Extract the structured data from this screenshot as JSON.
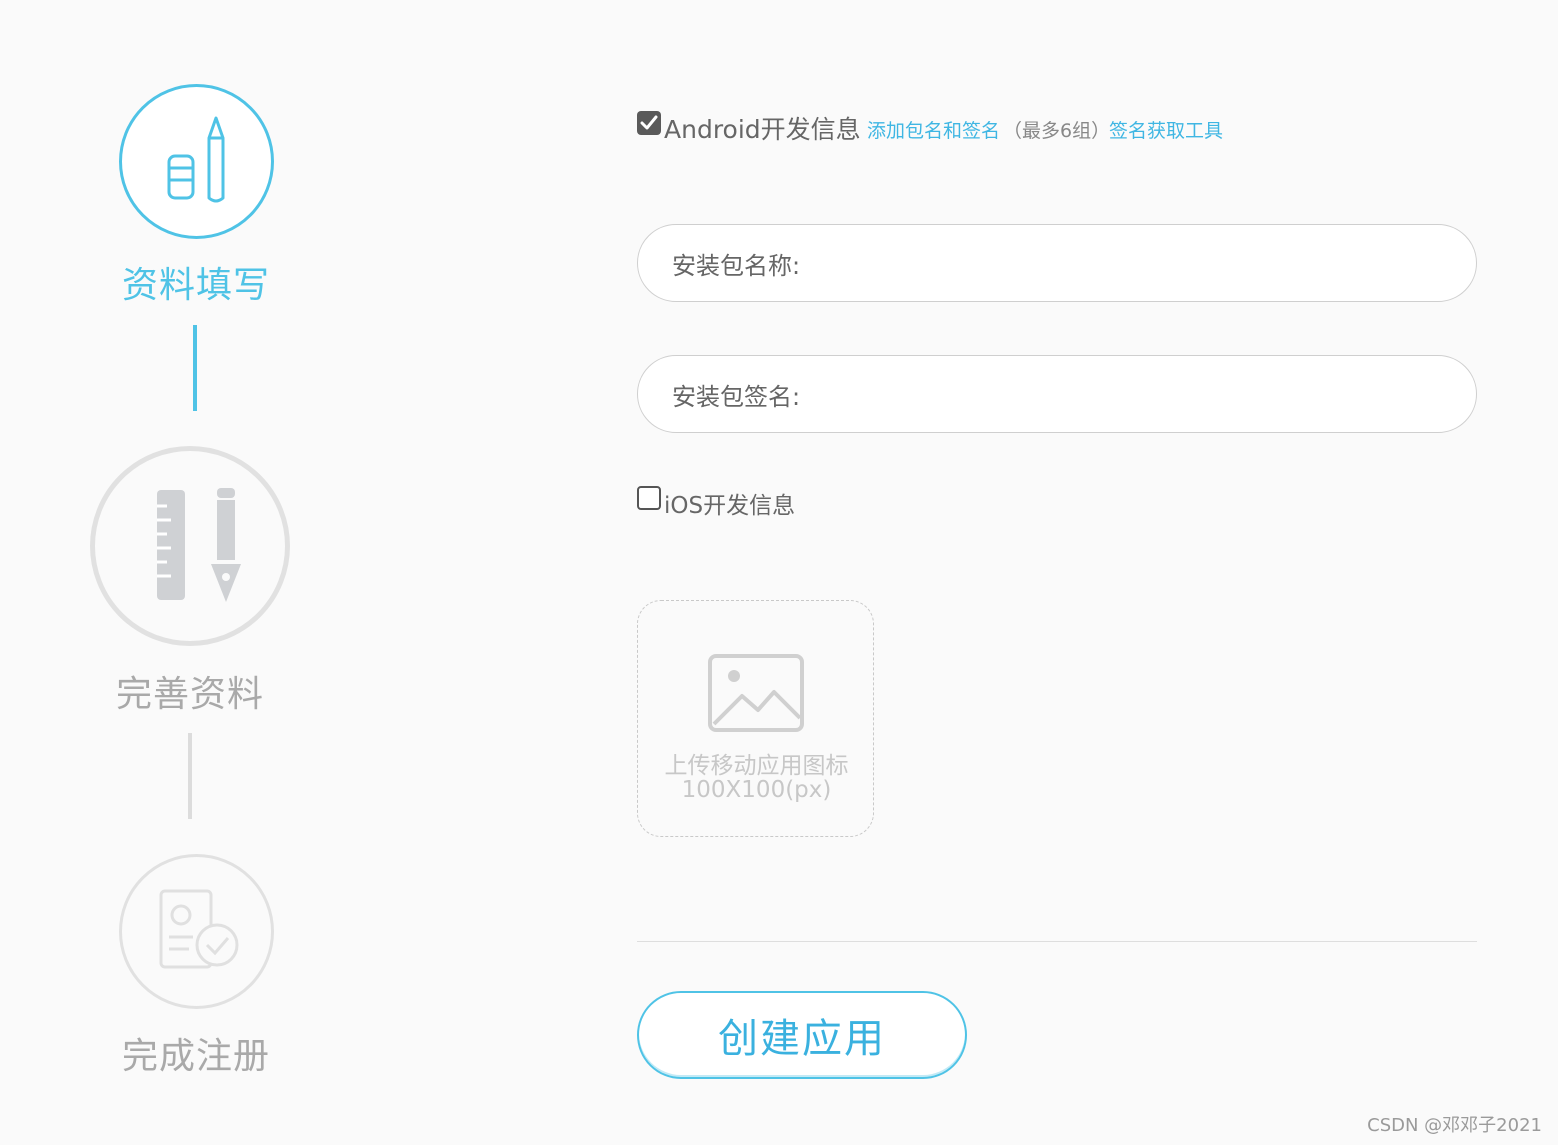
{
  "stepper": {
    "steps": [
      {
        "label": "资料填写",
        "state": "active"
      },
      {
        "label": "完善资料",
        "state": "inactive"
      },
      {
        "label": "完成注册",
        "state": "inactive"
      }
    ],
    "active_color": "#4fc3e6",
    "inactive_color": "#d9d9d9"
  },
  "android": {
    "checked": true,
    "label": "Android开发信息",
    "add_link": "添加包名和签名",
    "max_note": "（最多6组）",
    "tool_link": "签名获取工具",
    "package_name_label": "安装包名称:",
    "package_sign_label": "安装包签名:"
  },
  "ios": {
    "checked": false,
    "label": "iOS开发信息"
  },
  "upload": {
    "icon": "image-icon",
    "line1": "上传移动应用图标",
    "line2": "100X100(px)"
  },
  "actions": {
    "create_label": "创建应用"
  },
  "watermark": "CSDN @邓邓子2021"
}
